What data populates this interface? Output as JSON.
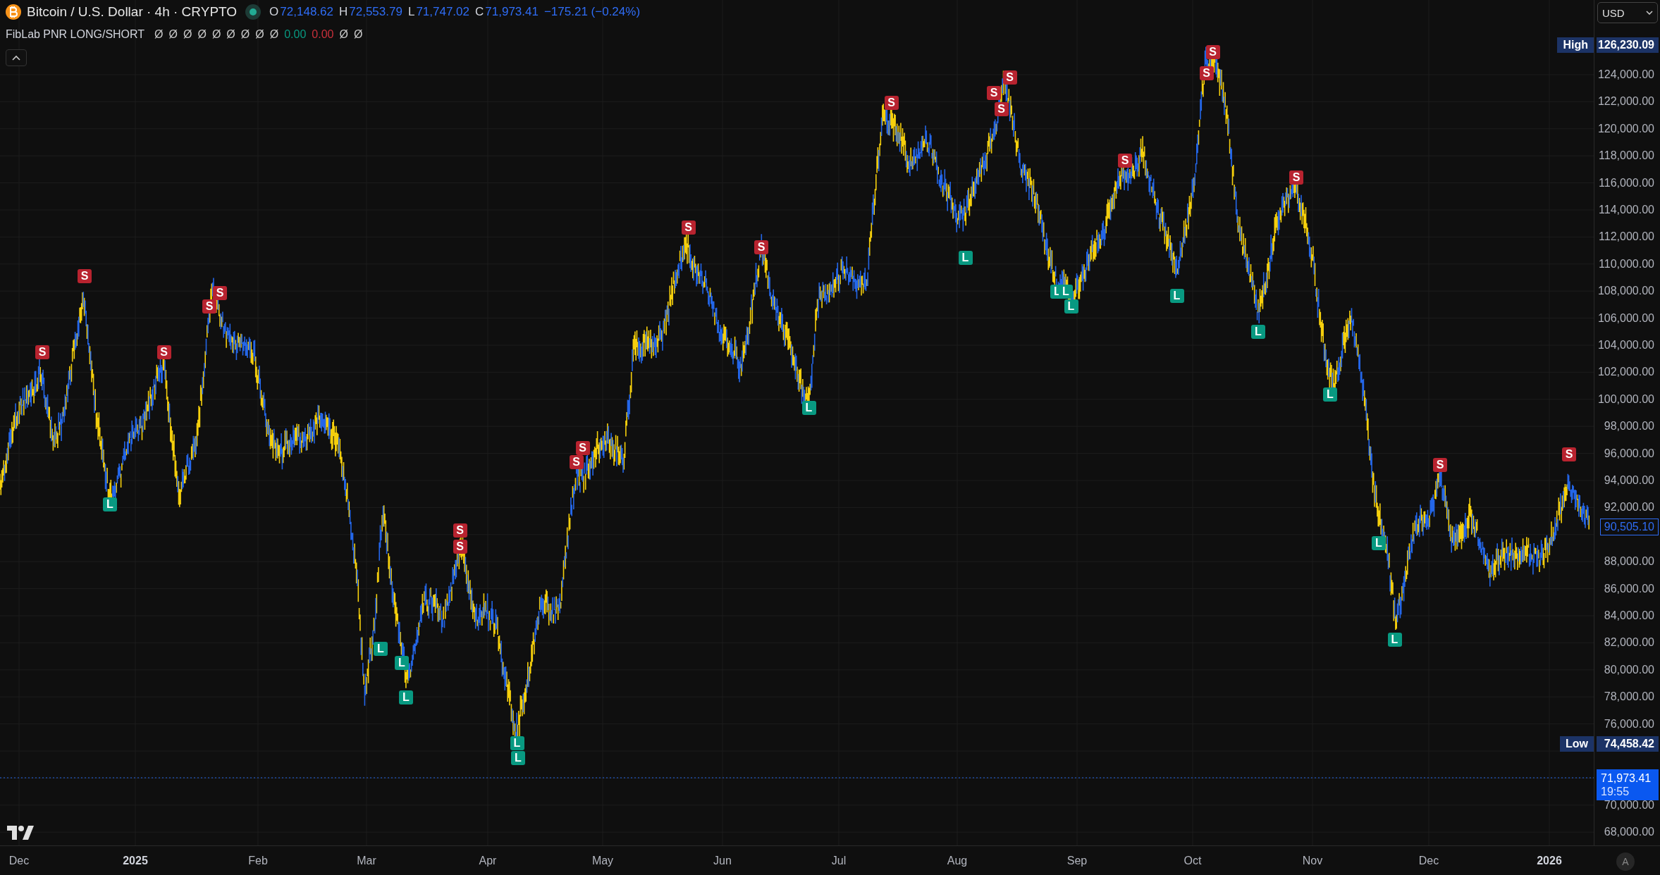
{
  "symbol": {
    "title": "Bitcoin / U.S. Dollar · 4h · CRYPTO",
    "market_open": true,
    "ohlc": [
      {
        "key": "O",
        "value": "72,148.62"
      },
      {
        "key": "H",
        "value": "72,553.79"
      },
      {
        "key": "L",
        "value": "71,747.02"
      },
      {
        "key": "C",
        "value": "71,973.41"
      }
    ],
    "change": "−175.21 (−0.24%)"
  },
  "indicator": {
    "name": "FibLab PNR LONG/SHORT",
    "values": [
      {
        "text": "Ø",
        "kind": "na"
      },
      {
        "text": "Ø",
        "kind": "na"
      },
      {
        "text": "Ø",
        "kind": "na"
      },
      {
        "text": "Ø",
        "kind": "na"
      },
      {
        "text": "Ø",
        "kind": "na"
      },
      {
        "text": "Ø",
        "kind": "na"
      },
      {
        "text": "Ø",
        "kind": "na"
      },
      {
        "text": "Ø",
        "kind": "na"
      },
      {
        "text": "Ø",
        "kind": "na"
      },
      {
        "text": "0.00",
        "kind": "positive"
      },
      {
        "text": "0.00",
        "kind": "negative"
      },
      {
        "text": "Ø",
        "kind": "na"
      },
      {
        "text": "Ø",
        "kind": "na"
      }
    ]
  },
  "currency": "USD",
  "price_axis": {
    "ticks": [
      "124,000.00",
      "122,000.00",
      "120,000.00",
      "118,000.00",
      "116,000.00",
      "114,000.00",
      "112,000.00",
      "110,000.00",
      "108,000.00",
      "106,000.00",
      "104,000.00",
      "102,000.00",
      "100,000.00",
      "98,000.00",
      "96,000.00",
      "94,000.00",
      "92,000.00",
      "88,000.00",
      "86,000.00",
      "84,000.00",
      "82,000.00",
      "80,000.00",
      "78,000.00",
      "76,000.00",
      "70,000.00",
      "68,000.00"
    ],
    "high": {
      "label": "High",
      "value": "126,230.09"
    },
    "low": {
      "label": "Low",
      "value": "74,458.42"
    },
    "last_visible": "90,505.10",
    "current": {
      "price": "71,973.41",
      "countdown": "19:55"
    }
  },
  "time_axis": [
    {
      "text": "Dec",
      "year": false
    },
    {
      "text": "2025",
      "year": true
    },
    {
      "text": "Feb",
      "year": false
    },
    {
      "text": "Mar",
      "year": false
    },
    {
      "text": "Apr",
      "year": false
    },
    {
      "text": "May",
      "year": false
    },
    {
      "text": "Jun",
      "year": false
    },
    {
      "text": "Jul",
      "year": false
    },
    {
      "text": "Aug",
      "year": false
    },
    {
      "text": "Sep",
      "year": false
    },
    {
      "text": "Oct",
      "year": false
    },
    {
      "text": "Nov",
      "year": false
    },
    {
      "text": "Dec",
      "year": false
    },
    {
      "text": "2026",
      "year": true
    }
  ],
  "signals": [
    {
      "kind": "short",
      "label": "S"
    },
    {
      "kind": "short",
      "label": "S"
    },
    {
      "kind": "short",
      "label": "S"
    },
    {
      "kind": "short",
      "label": "S"
    },
    {
      "kind": "short",
      "label": "S"
    },
    {
      "kind": "short",
      "label": "S"
    },
    {
      "kind": "short",
      "label": "S"
    },
    {
      "kind": "short",
      "label": "S"
    },
    {
      "kind": "short",
      "label": "S"
    },
    {
      "kind": "short",
      "label": "S"
    },
    {
      "kind": "short",
      "label": "S"
    },
    {
      "kind": "short",
      "label": "S"
    },
    {
      "kind": "short",
      "label": "S"
    },
    {
      "kind": "short",
      "label": "S"
    },
    {
      "kind": "short",
      "label": "S"
    },
    {
      "kind": "short",
      "label": "S"
    },
    {
      "kind": "short",
      "label": "S"
    },
    {
      "kind": "short",
      "label": "S"
    },
    {
      "kind": "short",
      "label": "S"
    },
    {
      "kind": "short",
      "label": "S"
    },
    {
      "kind": "short",
      "label": "S"
    },
    {
      "kind": "long",
      "label": "L"
    },
    {
      "kind": "long",
      "label": "L"
    },
    {
      "kind": "long",
      "label": "L"
    },
    {
      "kind": "long",
      "label": "L"
    },
    {
      "kind": "long",
      "label": "L"
    },
    {
      "kind": "long",
      "label": "L"
    },
    {
      "kind": "long",
      "label": "L"
    },
    {
      "kind": "long",
      "label": "L"
    },
    {
      "kind": "long",
      "label": "L"
    },
    {
      "kind": "long",
      "label": "L"
    },
    {
      "kind": "long",
      "label": "L"
    },
    {
      "kind": "long",
      "label": "L"
    },
    {
      "kind": "long",
      "label": "L"
    },
    {
      "kind": "long",
      "label": "L"
    },
    {
      "kind": "long",
      "label": "L"
    },
    {
      "kind": "long",
      "label": "L"
    }
  ],
  "auto_scale": "A"
}
